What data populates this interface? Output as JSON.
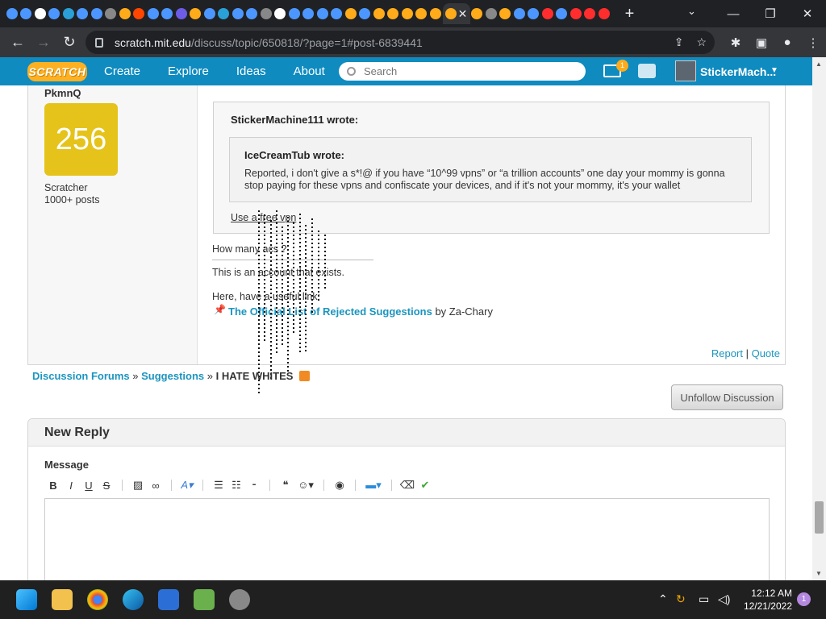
{
  "browser": {
    "url_domain": "scratch.mit.edu",
    "url_path": "/discuss/topic/650818/?page=1#post-6839441",
    "tab_favicon_colors": [
      "#4c97ff",
      "#4c97ff",
      "#ffffff",
      "#4c97ff",
      "#2aa0d8",
      "#4c97ff",
      "#4c97ff",
      "#888888",
      "#ffab1a",
      "#ff4500",
      "#4c97ff",
      "#4c97ff",
      "#6c5ce7",
      "#ffab1a",
      "#4c97ff",
      "#2aa0d8",
      "#4c97ff",
      "#4c97ff",
      "#888888",
      "#ffffff",
      "#4c97ff",
      "#4c97ff",
      "#4c97ff",
      "#4c97ff",
      "#ffab1a",
      "#4c97ff",
      "#ffab1a",
      "#ffab1a",
      "#ffab1a",
      "#ffab1a",
      "#ffab1a"
    ],
    "tabs_right_colors": [
      "#ffab1a",
      "#888888",
      "#ffab1a",
      "#4c97ff",
      "#4c97ff",
      "#ff2d2d",
      "#4c97ff",
      "#ff2d2d",
      "#ff2d2d",
      "#ff2d2d"
    ]
  },
  "scratch_header": {
    "logo": "SCRATCH",
    "nav": [
      "Create",
      "Explore",
      "Ideas",
      "About"
    ],
    "search_placeholder": "Search",
    "message_count": "1",
    "username": "StickerMach..."
  },
  "post": {
    "author": "PkmnQ",
    "avatar_text": "256",
    "rank": "Scratcher",
    "post_count": "1000+ posts",
    "quote_outer_author": "StickerMachine111 wrote:",
    "quote_inner_author": "IceCreamTub wrote:",
    "quote_inner_text": "Reported, i don't give a s*!@ if you have “10^99 vpns” or “a trillion accounts” one day your mommy is gonna stop paying for these vpns and confiscate your devices, and if it's not your mommy, it's your wallet",
    "quote_outer_text": "Use a free vpn",
    "body_line": "How many acs ?",
    "signature_line1": "This is an account that exists.",
    "signature_line2": "Here, have a useful link:",
    "signature_link": "The Official List of Rejected Suggestions",
    "signature_by": "by Za-Chary",
    "report": "Report",
    "separator": "|",
    "quote": "Quote"
  },
  "breadcrumb": {
    "forums": "Discussion Forums",
    "sep": "»",
    "category": "Suggestions",
    "topic": "I HATE WHITES"
  },
  "unfollow_button": "Unfollow Discussion",
  "reply": {
    "heading": "New Reply",
    "message_label": "Message",
    "toolbar": [
      "B",
      "I",
      "U",
      "S"
    ]
  },
  "taskbar": {
    "time": "12:12 AM",
    "date": "12/21/2022",
    "notifications": "1"
  }
}
